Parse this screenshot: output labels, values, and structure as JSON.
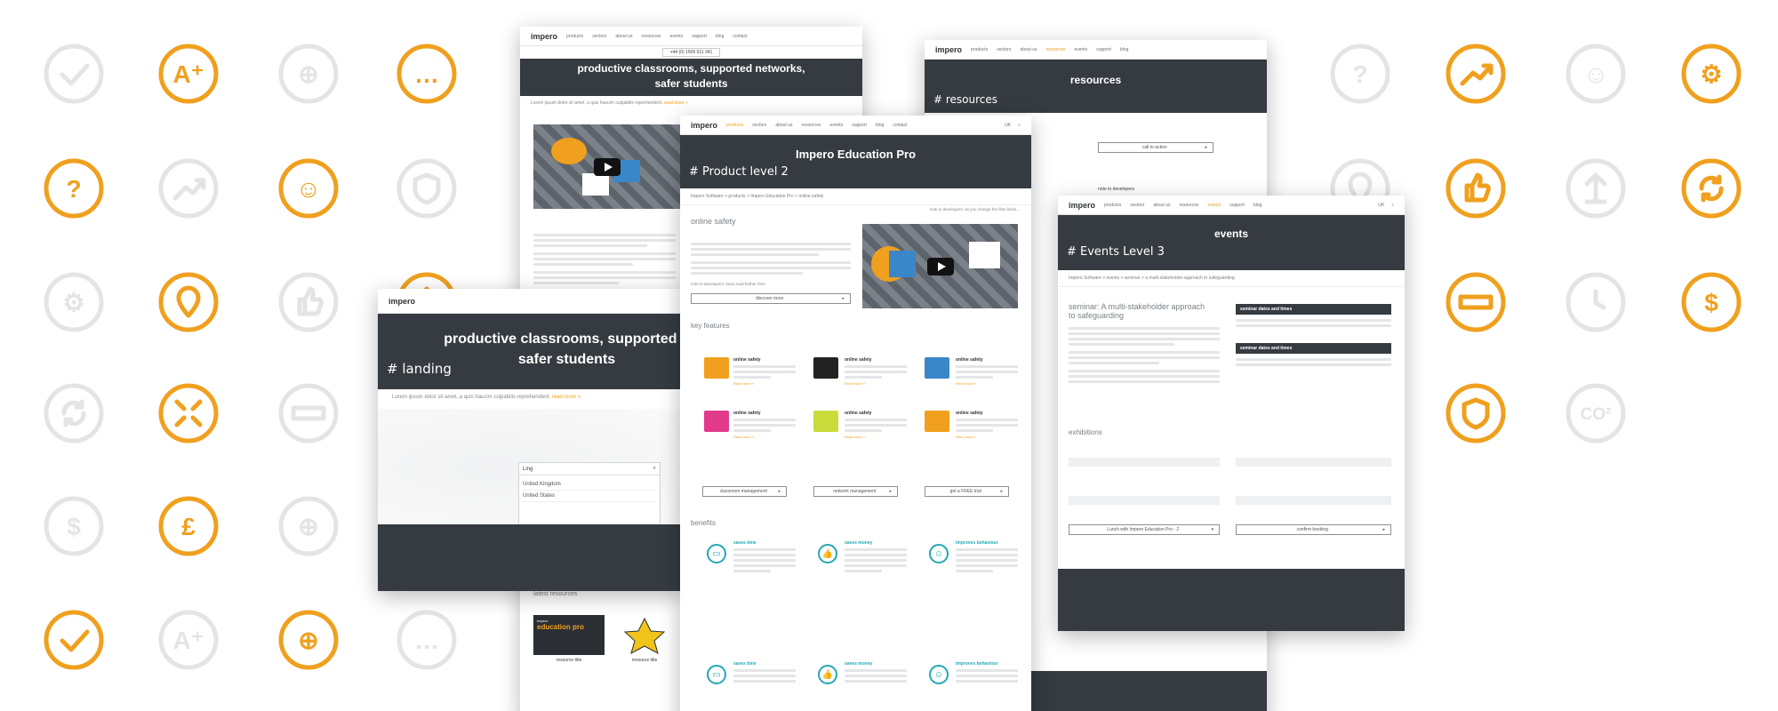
{
  "colors": {
    "accent": "#F0A01E",
    "faded": "#E3E4E6",
    "dark": "#353B40",
    "teal": "#23A8B5"
  },
  "background_icons": [
    {
      "name": "check-icon",
      "accent": false
    },
    {
      "name": "a-plus-icon",
      "accent": true
    },
    {
      "name": "target-icon",
      "accent": false
    },
    {
      "name": "chat-icon",
      "accent": true
    },
    {
      "name": "question-icon",
      "accent": true
    },
    {
      "name": "trend-up-icon",
      "accent": false
    },
    {
      "name": "smiley-icon",
      "accent": true
    },
    {
      "name": "shield-icon",
      "accent": false
    },
    {
      "name": "gear-icon",
      "accent": false
    },
    {
      "name": "location-pin-icon",
      "accent": true
    },
    {
      "name": "thumbs-up-icon",
      "accent": false
    },
    {
      "name": "arrows-expand-icon",
      "accent": true
    },
    {
      "name": "sync-icon",
      "accent": false
    },
    {
      "name": "arrows-collapse-icon",
      "accent": true
    },
    {
      "name": "password-icon",
      "accent": false
    },
    {
      "name": "clock-icon",
      "accent": true
    },
    {
      "name": "dollar-icon",
      "accent": false
    },
    {
      "name": "pound-icon",
      "accent": true
    },
    {
      "name": "target-icon",
      "accent": false
    },
    {
      "name": "co2-icon",
      "accent": true
    },
    {
      "name": "check-icon",
      "accent": true
    },
    {
      "name": "a-plus-icon",
      "accent": false
    },
    {
      "name": "target-icon",
      "accent": true
    },
    {
      "name": "chat-icon",
      "accent": false
    },
    {
      "name": "question-icon",
      "accent": false
    },
    {
      "name": "trend-up-icon",
      "accent": true
    },
    {
      "name": "smiley-icon",
      "accent": false
    },
    {
      "name": "gear-icon",
      "accent": true
    },
    {
      "name": "location-pin-icon",
      "accent": false
    },
    {
      "name": "thumbs-up-icon",
      "accent": true
    },
    {
      "name": "arrows-expand-icon",
      "accent": false
    },
    {
      "name": "sync-icon",
      "accent": true
    },
    {
      "name": "arrows-collapse-icon",
      "accent": false
    },
    {
      "name": "password-icon",
      "accent": true
    },
    {
      "name": "clock-icon",
      "accent": false
    },
    {
      "name": "dollar-icon",
      "accent": true
    },
    {
      "name": "pound-icon",
      "accent": false
    },
    {
      "name": "shield-icon",
      "accent": true
    },
    {
      "name": "co2-icon",
      "accent": false
    }
  ],
  "nav": {
    "logo": "impero",
    "links": [
      "products",
      "sectors",
      "about us",
      "resources",
      "events",
      "support",
      "blog",
      "contact",
      "customer portal"
    ],
    "region": "UK",
    "phone": "+44 (0) 1509 611 341"
  },
  "landing": {
    "title_line1": "productive classrooms, supported n",
    "title_line2": "safer students",
    "tag": "# landing",
    "intro": "Lorem ipsum dolor sit amet, a quis haucim culpabilis reprehenderit.",
    "read_more": "read more »",
    "search_value": "Ling",
    "dropdown": [
      "United Kingdom",
      "United States"
    ]
  },
  "product": {
    "title": "Impero Education Pro",
    "tag": "# Product level 2",
    "crumb": "Impero Software > products > Impero Education Pro > online safety",
    "note": "note to developers: as you change the filter block…",
    "section1": "online safety",
    "dev_note": "note to developers: have read further here",
    "discover": "discover more",
    "key_features": "key features",
    "features": [
      "online safety",
      "online safety",
      "online safety",
      "online safety",
      "online safety",
      "online safety"
    ],
    "read_more": "Read more »",
    "buttons": [
      "classroom management",
      "network management",
      "get a FREE trial"
    ],
    "benefits": "benefits",
    "benefit_titles": [
      "saves time",
      "saves money",
      "improves behaviour",
      "saves time",
      "saves money",
      "improves behaviour"
    ]
  },
  "top_left": {
    "title_line1": "productive classrooms, supported networks,",
    "title_line2": "safer students",
    "read_more": "read more »",
    "latest": "latest resources",
    "resources": [
      "resource title",
      "resource title"
    ],
    "card_brand": "education pro",
    "card_top": "Impero"
  },
  "resources_page": {
    "title": "resources",
    "tag": "# resources",
    "cta": "call to action",
    "note": "note to developers"
  },
  "events_page": {
    "title": "events",
    "tag": "# Events Level 3",
    "crumb": "Impero Software > events > seminar > a multi-stakeholder approach to safeguarding",
    "note": "note to developers",
    "heading_line1": "seminar: A multi-stakeholder approach",
    "heading_line2": "to safeguarding",
    "dates_head": "seminar dates and times",
    "exhibitions": "exhibitions",
    "lunch_select": "Lunch with Impero Education Pro - 2",
    "confirm": "confirm booking"
  }
}
